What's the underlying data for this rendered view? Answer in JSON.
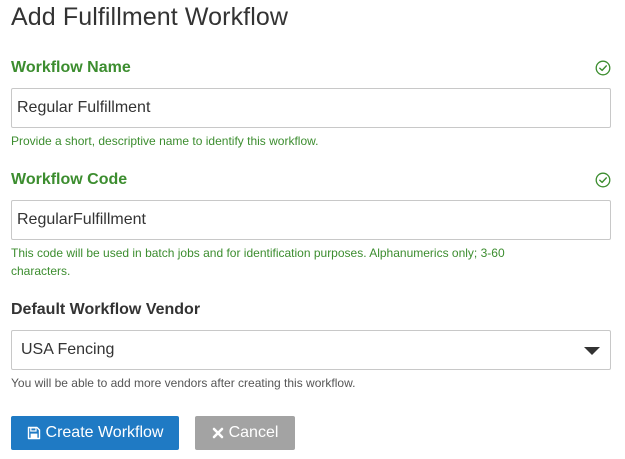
{
  "page": {
    "title": "Add Fulfillment Workflow"
  },
  "form": {
    "workflow_name": {
      "label": "Workflow Name",
      "value": "Regular Fulfillment",
      "help": "Provide a short, descriptive name to identify this workflow.",
      "status_icon": "check-circle-icon"
    },
    "workflow_code": {
      "label": "Workflow Code",
      "value": "RegularFulfillment",
      "help_line1": "This code will be used in batch jobs and for identification purposes. Alphanumerics only; 3-60",
      "help_line2": "characters.",
      "status_icon": "check-circle-icon"
    },
    "default_vendor": {
      "label": "Default Workflow Vendor",
      "selected": "USA Fencing",
      "help": "You will be able to add more vendors after creating this workflow."
    }
  },
  "actions": {
    "create_label": "Create Workflow",
    "create_icon": "save-icon",
    "cancel_label": "Cancel",
    "cancel_icon": "close-icon"
  },
  "colors": {
    "valid_green": "#3c8d2f",
    "primary_blue": "#1f7ac4",
    "cancel_gray": "#a3a3a3"
  }
}
